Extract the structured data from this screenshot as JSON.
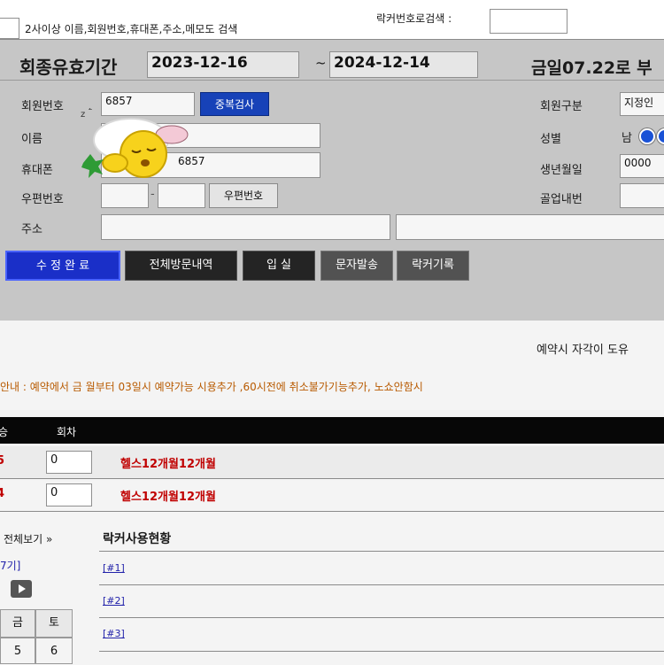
{
  "topbar": {
    "checkbox_desc": "2사이상 이름,회원번호,휴대폰,주소,메모도 검색",
    "locker_search_label": "락커번호로검색 :",
    "locker_search_value": ""
  },
  "period": {
    "label": "회종유효기간",
    "start": "2023-12-16",
    "sep": "~",
    "end": "2024-12-14",
    "right_text": "금일07.22로 부"
  },
  "form": {
    "member_no_label": "회원번호",
    "member_no_value": "6857",
    "dup_check_label": "중복검사",
    "member_type_label": "회원구분",
    "member_type_value": "지정인",
    "name_label": "이름",
    "name_value": "",
    "gender_label": "성별",
    "gender_value": "남",
    "phone_label": "휴대폰",
    "phone_value": "6857",
    "birth_label": "생년월일",
    "birth_value": "0000",
    "zip_label": "우편번호",
    "zip_button": "우편번호",
    "company_label": "골업내번",
    "address_label": "주소"
  },
  "actions": {
    "save": "수 정 완 료",
    "history": "전체방문내역",
    "enter": "입 실",
    "sms": "문자발송",
    "locker_record": "락커기록"
  },
  "reservation_right": "예약시 자각이 도유",
  "notice": "안내 : 예약에서 금 월부터 03일시 예약가능 시용추가 ,60시전에 취소불가기능추가, 노쇼안함시",
  "table": {
    "headers": [
      "승",
      "회차"
    ],
    "rows": [
      {
        "mark": "5",
        "count": "0",
        "name": "헬스12개월12개월"
      },
      {
        "mark": "4",
        "count": "0",
        "name": "헬스12개월12개월"
      }
    ]
  },
  "lower": {
    "detail_view": "전체보기 »",
    "year_link": "7기]",
    "locker_title": "락커사용현황",
    "locker_rows": [
      "[#1]",
      "[#2]",
      "[#3]"
    ],
    "cal_headers": [
      "금",
      "토"
    ],
    "cal_values": [
      "5",
      "6"
    ]
  },
  "colors": {
    "panel_bg": "#c6c6c6",
    "blue_button": "#1a2fc8",
    "dark_button": "#242424",
    "red_text": "#c00000",
    "notice_text": "#b85a00"
  }
}
